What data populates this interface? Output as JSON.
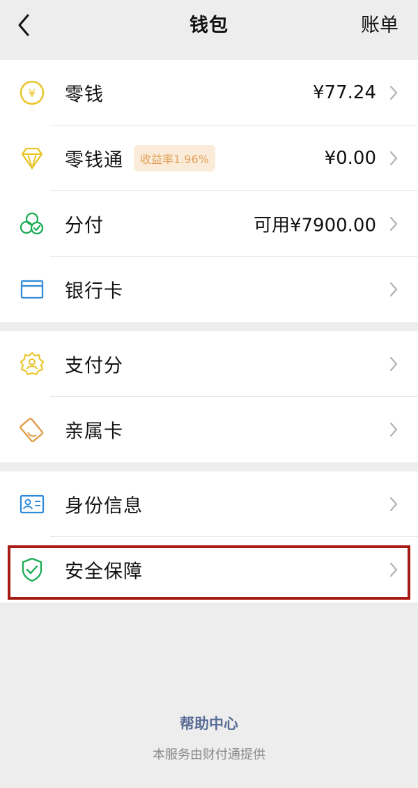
{
  "nav": {
    "back_icon": "chevron-left-icon",
    "title": "钱包",
    "bill_label": "账单"
  },
  "group1": [
    {
      "label": "零钱",
      "value": "¥77.24",
      "icon": "yen-coin-icon"
    },
    {
      "label": "零钱通",
      "badge": "收益率1.96%",
      "value": "¥0.00",
      "icon": "diamond-icon"
    },
    {
      "label": "分付",
      "value": "可用¥7900.00",
      "icon": "circles-check-icon"
    },
    {
      "label": "银行卡",
      "value": "",
      "icon": "bank-card-icon"
    }
  ],
  "group2": [
    {
      "label": "支付分",
      "icon": "badge-person-icon"
    },
    {
      "label": "亲属卡",
      "icon": "family-card-icon"
    }
  ],
  "group3": [
    {
      "label": "身份信息",
      "icon": "id-card-icon"
    },
    {
      "label": "安全保障",
      "icon": "shield-check-icon"
    }
  ],
  "footer": {
    "help_center": "帮助中心",
    "provider_note": "本服务由财付通提供"
  },
  "colors": {
    "yellow": "#e9c52a",
    "green": "#1aad55",
    "blue": "#2f8ad8",
    "orange": "#e29a46",
    "highlight": "#a61c14",
    "link": "#576b95"
  }
}
